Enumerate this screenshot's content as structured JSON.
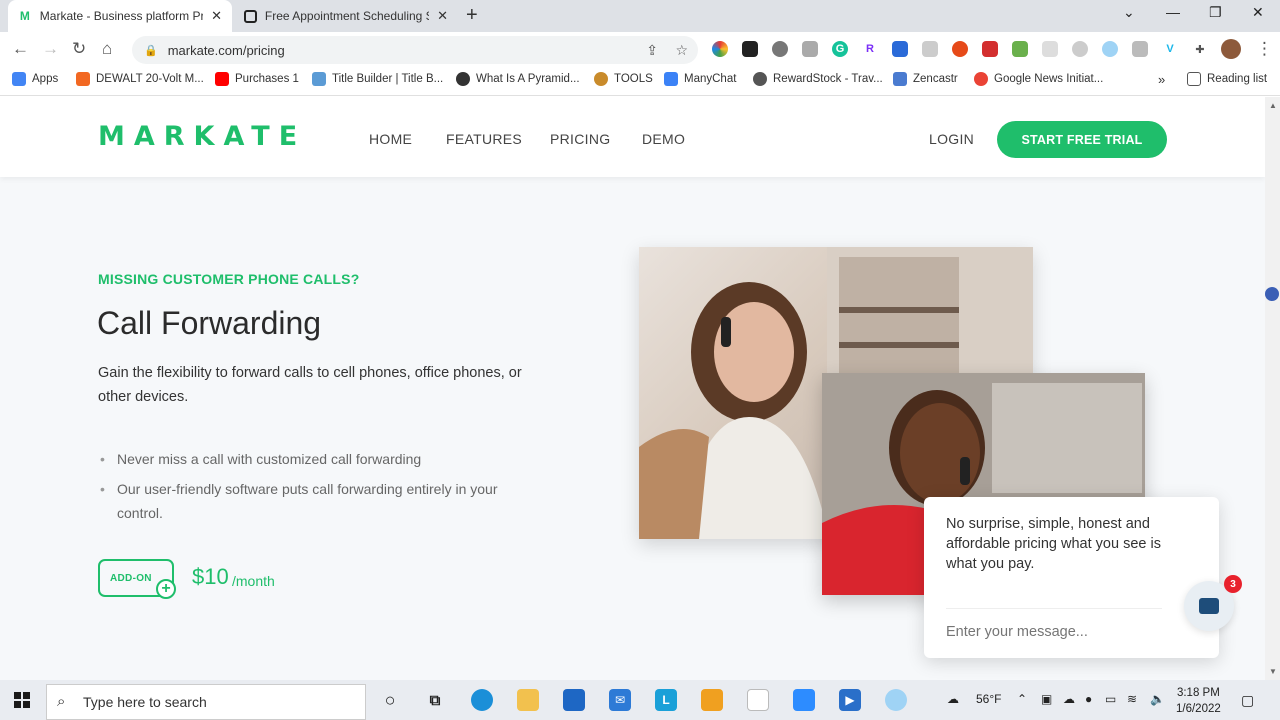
{
  "browser": {
    "tabs": [
      {
        "title": "Markate - Business platform Pric",
        "active": true,
        "favicon": "M"
      },
      {
        "title": "Free Appointment Scheduling So",
        "active": false,
        "favicon": "square-logo"
      }
    ],
    "url": "markate.com/pricing",
    "bookmarks": [
      {
        "label": "Apps",
        "color": "#4285f4"
      },
      {
        "label": "DEWALT 20-Volt M...",
        "color": "#f26822"
      },
      {
        "label": "Purchases 1",
        "color": "#ff0000"
      },
      {
        "label": "Title Builder | Title B...",
        "color": "#5b9bd5"
      },
      {
        "label": "What Is A Pyramid...",
        "color": "#333333"
      },
      {
        "label": "TOOLS",
        "color": "#c98b2b"
      },
      {
        "label": "ManyChat",
        "color": "#3b82f6"
      },
      {
        "label": "RewardStock - Trav...",
        "color": "#555555"
      },
      {
        "label": "Zencastr",
        "color": "#4a7bd0"
      },
      {
        "label": "Google News Initiat...",
        "color": "#ea4335"
      }
    ],
    "reading_list": "Reading list"
  },
  "site": {
    "logo": "MARKATE",
    "nav": [
      "HOME",
      "FEATURES",
      "PRICING",
      "DEMO"
    ],
    "login": "LOGIN",
    "cta": "START FREE TRIAL",
    "accent_color": "#1fbe6b"
  },
  "feature": {
    "eyebrow": "MISSING CUSTOMER PHONE CALLS?",
    "title": "Call Forwarding",
    "description": "Gain the flexibility to forward calls to cell phones, office phones, or other devices.",
    "bullets": [
      "Never miss a call with customized call forwarding",
      "Our user-friendly software puts call forwarding entirely in your control."
    ],
    "addon_label": "ADD-ON",
    "price": "$10",
    "period": "/month"
  },
  "chat": {
    "message": "No surprise, simple, honest and affordable pricing what you see is what you pay.",
    "placeholder": "Enter your message...",
    "badge": "3"
  },
  "taskbar": {
    "search_placeholder": "Type here to search",
    "weather": "56°F",
    "time": "3:18 PM",
    "date": "1/6/2022"
  }
}
